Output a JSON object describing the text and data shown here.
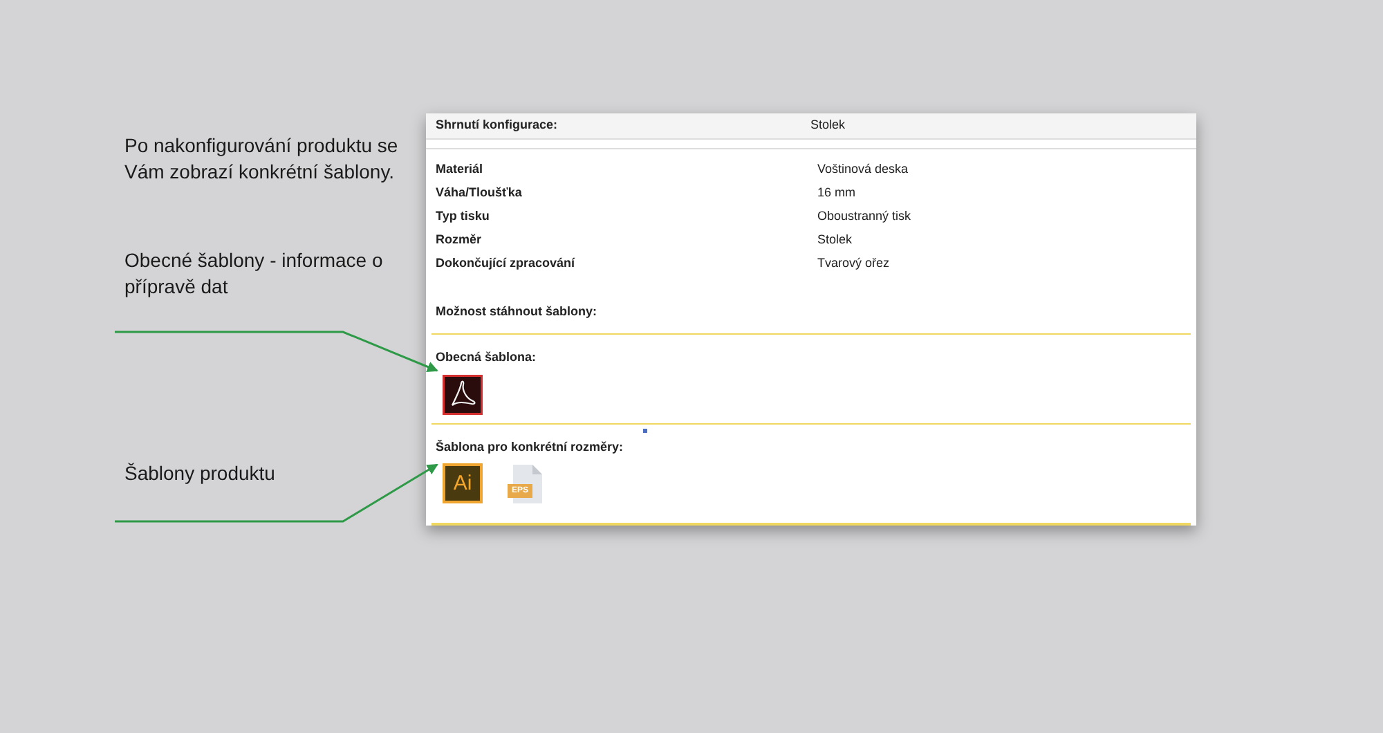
{
  "annotations": [
    {
      "text": "Po nakonfigurování produktu se Vám zobrazí konkrétní šablony.",
      "arrow": false
    },
    {
      "text": "Obecné šablony - informace o přípravě dat",
      "arrow": true
    },
    {
      "text": "Šablony produktu",
      "arrow": true
    }
  ],
  "summary": {
    "label": "Shrnutí konfigurace:",
    "value": "Stolek"
  },
  "rows": [
    {
      "label": "Materiál",
      "value": "Voštinová deska"
    },
    {
      "label": "Váha/Tloušťka",
      "value": "16 mm"
    },
    {
      "label": "Typ tisku",
      "value": "Oboustranný tisk"
    },
    {
      "label": "Rozměr",
      "value": "Stolek"
    },
    {
      "label": "Dokončující zpracování",
      "value": "Tvarový ořez"
    }
  ],
  "download_title": "Možnost stáhnout šablony:",
  "sections": [
    {
      "title": "Obecná šablona:",
      "files": [
        {
          "kind": "pdf"
        }
      ]
    },
    {
      "title": "Šablona pro konkrétní rozměry:",
      "files": [
        {
          "kind": "ai",
          "label": "Ai"
        },
        {
          "kind": "eps",
          "label": "EPS"
        }
      ]
    }
  ]
}
